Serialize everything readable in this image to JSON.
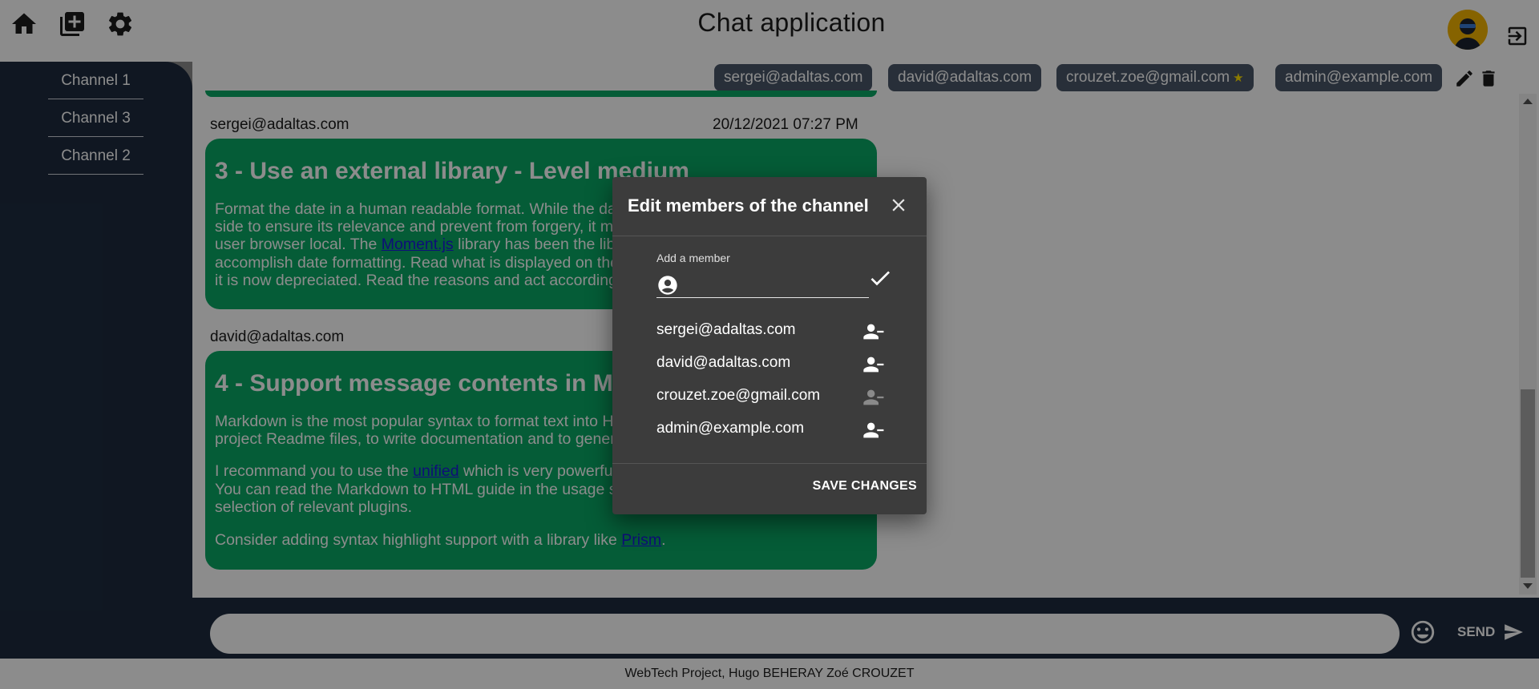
{
  "header": {
    "title": "Chat application",
    "icons": [
      "home-icon",
      "add-box-icon",
      "gear-icon",
      "logout-icon"
    ]
  },
  "sidebar": {
    "channels": [
      {
        "label": "Channel 1"
      },
      {
        "label": "Channel 3"
      },
      {
        "label": "Channel 2"
      }
    ]
  },
  "members_bar": {
    "members": [
      {
        "email": "sergei@adaltas.com",
        "owner": false
      },
      {
        "email": "david@adaltas.com",
        "owner": false
      },
      {
        "email": "crouzet.zoe@gmail.com",
        "owner": true,
        "owner_mark": "★"
      },
      {
        "email": "admin@example.com",
        "owner": false
      }
    ]
  },
  "messages": [
    {
      "author": "sergei@adaltas.com",
      "date": "20/12/2021 07:27 PM",
      "title": "3 - Use an external library - Level medium",
      "paragraphs": [
        {
          "before": "Format the date in a human readable format. While the date must be generated on the server side to ensure its relevance and prevent from forgery, it must be displayed according to the user browser local. The ",
          "link": "Moment.js",
          "after": " library has been the library of choice for many years to accomplish date formatting. Read what is displayed on the top right corner of their homepage, it is now depreciated. Read the reasons and act accordingly."
        }
      ]
    },
    {
      "author": "david@adaltas.com",
      "date": "",
      "title": "4 - Support message contents in Markdown - Level hard",
      "paragraphs": [
        {
          "before": "Markdown is the most popular syntax to format text into HTML. It is used for the majority of the project Readme files, to write documentation and to generate websites.",
          "link": "",
          "after": ""
        },
        {
          "before": "I recommand you to use the ",
          "link": "unified",
          "after": " which is very powerful and comes with a lot of plugins. You can read the Markdown to HTML guide in the usage section and enrich it with your selection of relevant plugins."
        },
        {
          "before": "Consider adding syntax highlight support with a library like ",
          "link": "Prism",
          "after": "."
        }
      ]
    }
  ],
  "composer": {
    "placeholder": "",
    "send_label": "SEND"
  },
  "footer": {
    "text": "WebTech Project, Hugo BEHERAY Zoé CROUZET"
  },
  "dialog": {
    "title": "Edit members of the channel",
    "add_label": "Add a member",
    "add_value": "",
    "members": [
      {
        "email": "sergei@adaltas.com",
        "removable": true
      },
      {
        "email": "david@adaltas.com",
        "removable": true
      },
      {
        "email": "crouzet.zoe@gmail.com",
        "removable": false
      },
      {
        "email": "admin@example.com",
        "removable": true
      }
    ],
    "save_label": "SAVE CHANGES"
  },
  "colors": {
    "sidebar": "#1e2b3f",
    "bubble": "#0aa864",
    "chip": "#4a5668",
    "dialog": "#3c3c3c",
    "star": "#ffe100"
  }
}
